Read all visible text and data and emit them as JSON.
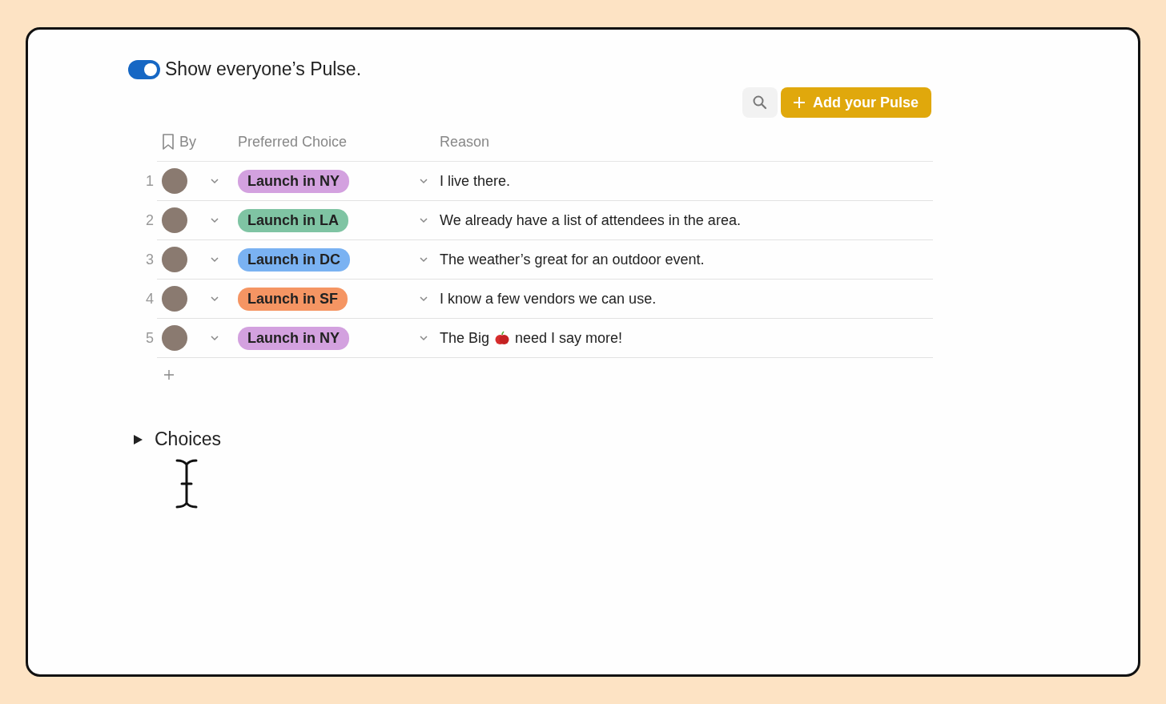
{
  "toggle": {
    "label": "Show everyone’s Pulse.",
    "on": true
  },
  "add_button": {
    "label": "Add your Pulse"
  },
  "table": {
    "columns": [
      "By",
      "Preferred Choice",
      "Reason"
    ],
    "rows": [
      {
        "number": "1",
        "choice": "Launch in NY",
        "color": "#d3a1df",
        "reason": [
          "I live there."
        ]
      },
      {
        "number": "2",
        "choice": "Launch in LA",
        "color": "#7fc4a3",
        "reason": [
          "We already have a list of attendees in the area."
        ]
      },
      {
        "number": "3",
        "choice": "Launch in DC",
        "color": "#7ab2f2",
        "reason": [
          "The weather’s great for an outdoor event."
        ]
      },
      {
        "number": "4",
        "choice": "Launch in SF",
        "color": "#f59563",
        "reason": [
          "I know a few vendors we can use."
        ]
      },
      {
        "number": "5",
        "choice": "Launch in NY",
        "color": "#d3a1df",
        "reason": [
          "The Big",
          "need I say more!"
        ]
      }
    ]
  },
  "section": {
    "title": "Choices",
    "expanded": false
  }
}
